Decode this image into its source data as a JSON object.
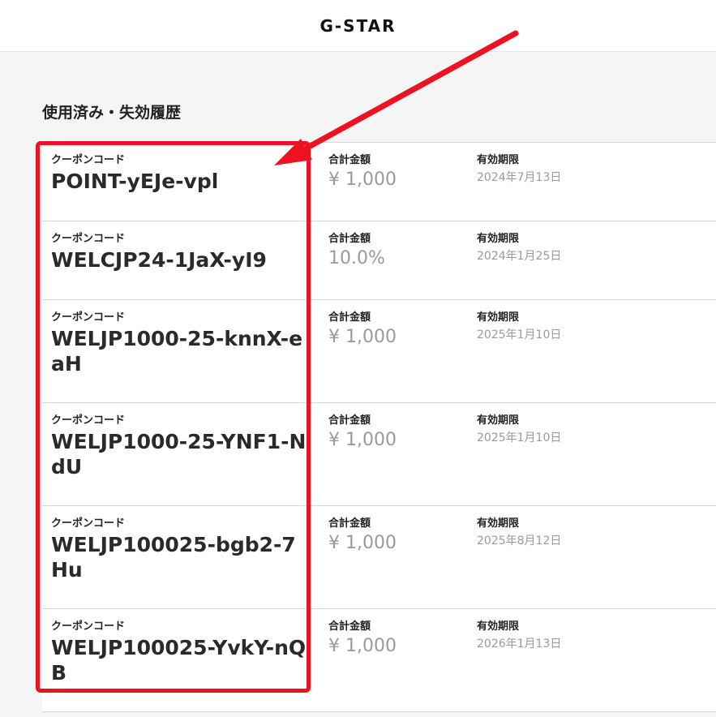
{
  "header": {
    "logo": "G-STAR"
  },
  "section": {
    "title": "使用済み・失効履歴"
  },
  "labels": {
    "code": "クーポンコード",
    "amount": "合計金額",
    "expiry": "有効期限"
  },
  "coupons": [
    {
      "code": "POINT-yEJe-vpl",
      "amount": "¥ 1,000",
      "expiry": "2024年7月13日"
    },
    {
      "code": "WELCJP24-1JaX-yI9",
      "amount": "10.0%",
      "expiry": "2024年1月25日"
    },
    {
      "code": "WELJP1000-25-knnX-eaH",
      "amount": "¥ 1,000",
      "expiry": "2025年1月10日"
    },
    {
      "code": "WELJP1000-25-YNF1-NdU",
      "amount": "¥ 1,000",
      "expiry": "2025年1月10日"
    },
    {
      "code": "WELJP100025-bgb2-7Hu",
      "amount": "¥ 1,000",
      "expiry": "2025年8月12日"
    },
    {
      "code": "WELJP100025-YvkY-nQB",
      "amount": "¥ 1,000",
      "expiry": "2026年1月13日"
    }
  ],
  "colors": {
    "annotation": "#ee1122",
    "muted": "#9a9a9a"
  }
}
